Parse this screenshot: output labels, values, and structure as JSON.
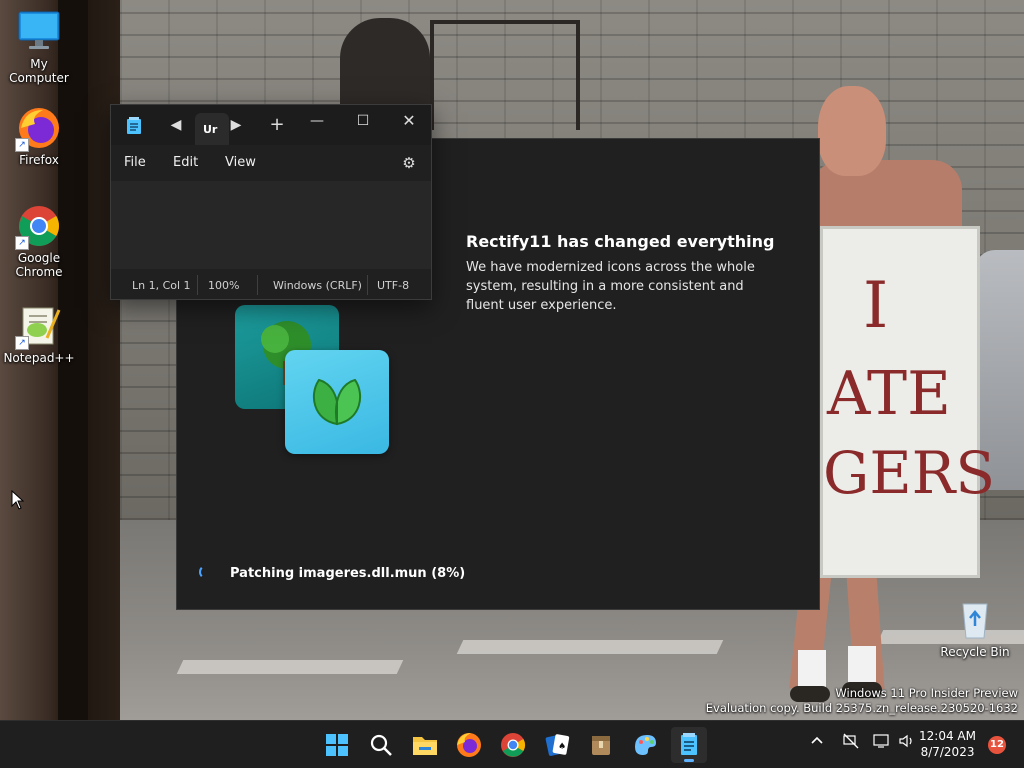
{
  "desktop": {
    "icons": [
      {
        "label": "My Computer",
        "icon": "monitor-icon"
      },
      {
        "label": "Firefox",
        "icon": "firefox-icon"
      },
      {
        "label": "Google Chrome",
        "icon": "chrome-icon"
      },
      {
        "label": "Notepad++",
        "icon": "notepad-plus-plus-icon"
      },
      {
        "label": "Recycle Bin",
        "icon": "recycle-bin-icon"
      }
    ],
    "sign_lines": [
      "I",
      "ATE",
      "GERS"
    ]
  },
  "installer": {
    "title": "Rectify11 has changed everything",
    "description": "We have modernized icons across the whole system, resulting in a more consistent and fluent user experience.",
    "status": "Patching imageres.dll.mun (8%)"
  },
  "notepad": {
    "tab_title": "Ur",
    "menu": {
      "file": "File",
      "edit": "Edit",
      "view": "View"
    },
    "status": {
      "position": "Ln 1, Col 1",
      "zoom": "100%",
      "line_ending": "Windows (CRLF)",
      "encoding": "UTF-8"
    }
  },
  "watermark": {
    "line1": "Windows 11 Pro Insider Preview",
    "line2": "Evaluation copy. Build 25375.zn_release.230520-1632"
  },
  "taskbar": {
    "apps": [
      "start",
      "search",
      "file-explorer",
      "firefox",
      "chrome",
      "solitaire",
      "archive",
      "paint",
      "notepad"
    ],
    "clock": {
      "time": "12:04 AM",
      "date": "8/7/2023"
    },
    "notification_count": "12"
  },
  "colors": {
    "accent": "#5fb2ff",
    "window_bg": "#202020",
    "taskbar_bg": "#1f1f1f",
    "notification": "#e8533d"
  }
}
